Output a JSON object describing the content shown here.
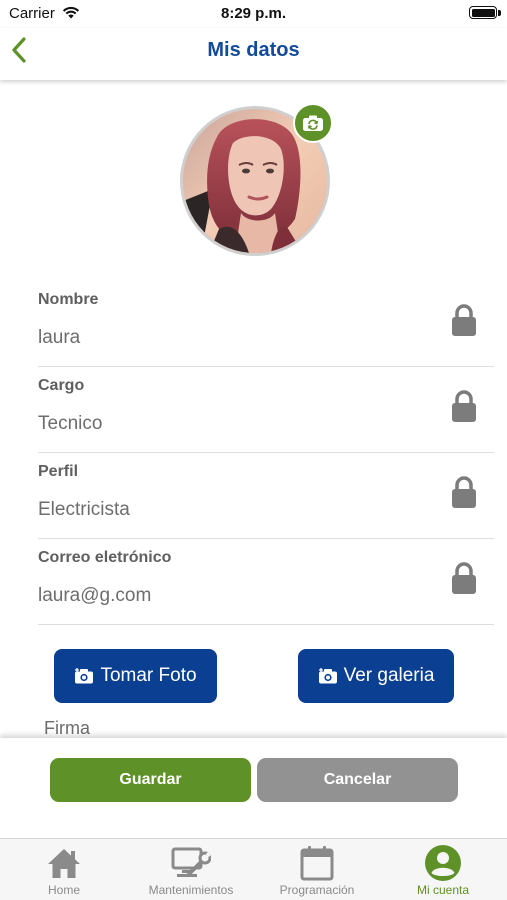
{
  "status_bar": {
    "carrier": "Carrier",
    "time": "8:29 p.m."
  },
  "header": {
    "title": "Mis datos"
  },
  "profile": {
    "fields": [
      {
        "label": "Nombre",
        "value": "laura"
      },
      {
        "label": "Cargo",
        "value": "Tecnico"
      },
      {
        "label": "Perfil",
        "value": "Electricista"
      },
      {
        "label": "Correo eletrónico",
        "value": "laura@g.com"
      }
    ]
  },
  "photo_actions": {
    "take_photo": "Tomar Foto",
    "gallery": "Ver galeria"
  },
  "signature": {
    "label": "Firma"
  },
  "actions": {
    "save": "Guardar",
    "cancel": "Cancelar"
  },
  "tab_bar": {
    "items": [
      {
        "label": "Home",
        "icon": "home-icon"
      },
      {
        "label": "Mantenimientos",
        "icon": "maintenance-icon"
      },
      {
        "label": "Programación",
        "icon": "calendar-icon"
      },
      {
        "label": "Mi cuenta",
        "icon": "account-icon",
        "active": true
      }
    ]
  },
  "colors": {
    "brand_green": "#5e9127",
    "brand_blue": "#0a3f92",
    "title_blue": "#124a9c",
    "cancel_gray": "#929292"
  }
}
